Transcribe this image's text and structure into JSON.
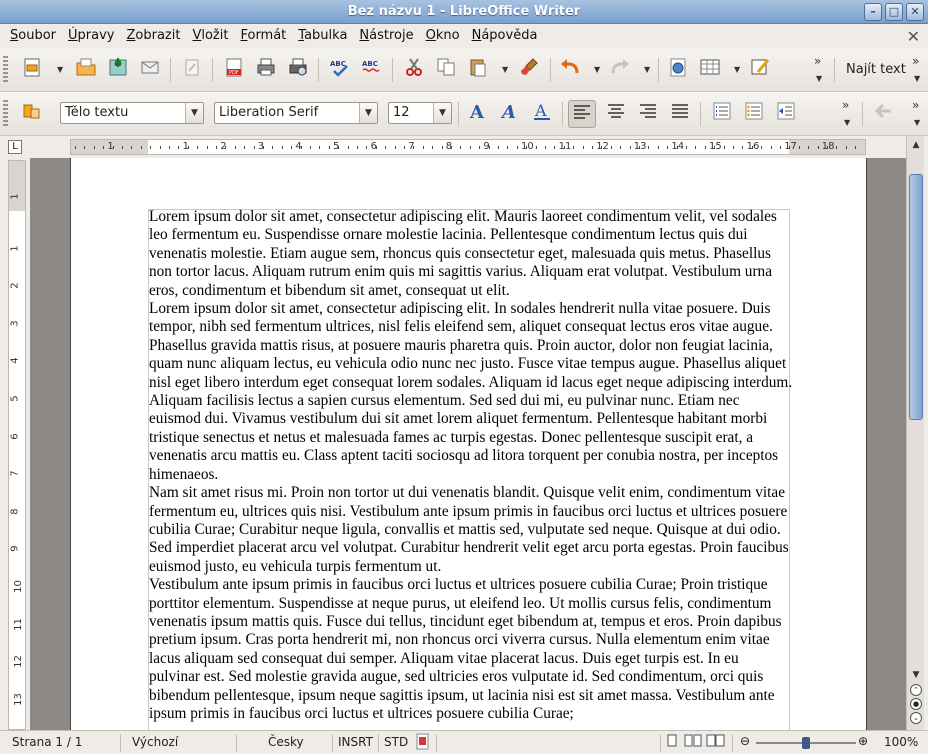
{
  "window": {
    "title": "Bez názvu 1 - LibreOffice Writer"
  },
  "menubar": {
    "items": [
      "Soubor",
      "Úpravy",
      "Zobrazit",
      "Vložit",
      "Formát",
      "Tabulka",
      "Nástroje",
      "Okno",
      "Nápověda"
    ]
  },
  "toolbar": {
    "find_label": "Najít text"
  },
  "formatting": {
    "paragraph_style": "Tělo textu",
    "font_name": "Liberation Serif",
    "font_size": "12"
  },
  "ruler": {
    "h_numbers": [
      "1",
      "1",
      "2",
      "3",
      "4",
      "5",
      "6",
      "7",
      "8",
      "9",
      "10",
      "11",
      "12",
      "13",
      "14",
      "15",
      "16",
      "17",
      "18"
    ],
    "v_numbers": [
      "1",
      "1",
      "2",
      "3",
      "4",
      "5",
      "6",
      "7",
      "8",
      "9",
      "10",
      "11",
      "12",
      "13"
    ]
  },
  "document": {
    "paragraphs": [
      "Lorem ipsum dolor sit amet, consectetur adipiscing elit. Mauris laoreet condimentum velit, vel sodales leo fermentum eu. Suspendisse ornare molestie lacinia. Pellentesque condimentum lectus quis dui venenatis molestie. Etiam augue sem, rhoncus quis consectetur eget, malesuada quis metus. Phasellus non tortor lacus. Aliquam rutrum enim quis mi sagittis varius. Aliquam erat volutpat. Vestibulum urna eros, condimentum et bibendum sit amet, consequat ut elit.",
      "Lorem ipsum dolor sit amet, consectetur adipiscing elit. In sodales hendrerit nulla vitae posuere. Duis tempor, nibh sed fermentum ultrices, nisl felis eleifend sem, aliquet consequat lectus eros vitae augue. Phasellus gravida mattis risus, at posuere mauris pharetra quis. Proin auctor, dolor non feugiat lacinia, quam nunc aliquam lectus, eu vehicula odio nunc nec justo. Fusce vitae tempus augue. Phasellus aliquet nisl eget libero interdum eget consequat lorem sodales. Aliquam id lacus eget neque adipiscing interdum. Aliquam facilisis lectus a sapien cursus elementum. Sed sed dui mi, eu pulvinar nunc. Etiam nec euismod dui. Vivamus vestibulum dui sit amet lorem aliquet fermentum. Pellentesque habitant morbi tristique senectus et netus et malesuada fames ac turpis egestas. Donec pellentesque suscipit erat, a venenatis arcu mattis eu. Class aptent taciti sociosqu ad litora torquent per conubia nostra, per inceptos himenaeos.",
      "Nam sit amet risus mi. Proin non tortor ut dui venenatis blandit. Quisque velit enim, condimentum vitae fermentum eu, ultrices quis nisi. Vestibulum ante ipsum primis in faucibus orci luctus et ultrices posuere cubilia Curae; Curabitur neque ligula, convallis et mattis sed, vulputate sed neque. Quisque at dui odio. Sed imperdiet placerat arcu vel volutpat. Curabitur hendrerit velit eget arcu porta egestas. Proin faucibus euismod justo, eu vehicula turpis fermentum ut.",
      "Vestibulum ante ipsum primis in faucibus orci luctus et ultrices posuere cubilia Curae; Proin tristique porttitor elementum. Suspendisse at neque purus, ut eleifend leo. Ut mollis cursus felis, condimentum venenatis ipsum mattis quis. Fusce dui tellus, tincidunt eget bibendum at, tempus et eros. Proin dapibus pretium ipsum. Cras porta hendrerit mi, non rhoncus orci viverra cursus. Nulla elementum enim vitae lacus aliquam sed consequat dui semper. Aliquam vitae placerat lacus. Duis eget turpis est. In eu pulvinar est. Sed molestie gravida augue, sed ultricies eros vulputate id. Sed condimentum, orci quis bibendum pellentesque, ipsum neque sagittis ipsum, ut lacinia nisi est sit amet massa. Vestibulum ante ipsum primis in faucibus orci luctus et ultrices posuere cubilia Curae;"
    ]
  },
  "statusbar": {
    "page": "Strana 1 / 1",
    "page_style": "Výchozí",
    "language": "Česky",
    "insert_mode": "INSRT",
    "selection_mode": "STD",
    "zoom": "100%"
  },
  "colors": {
    "titlebar": "#7a9fcb",
    "scroll_thumb": "#7fa2d1",
    "doc_background": "#8c8986"
  }
}
